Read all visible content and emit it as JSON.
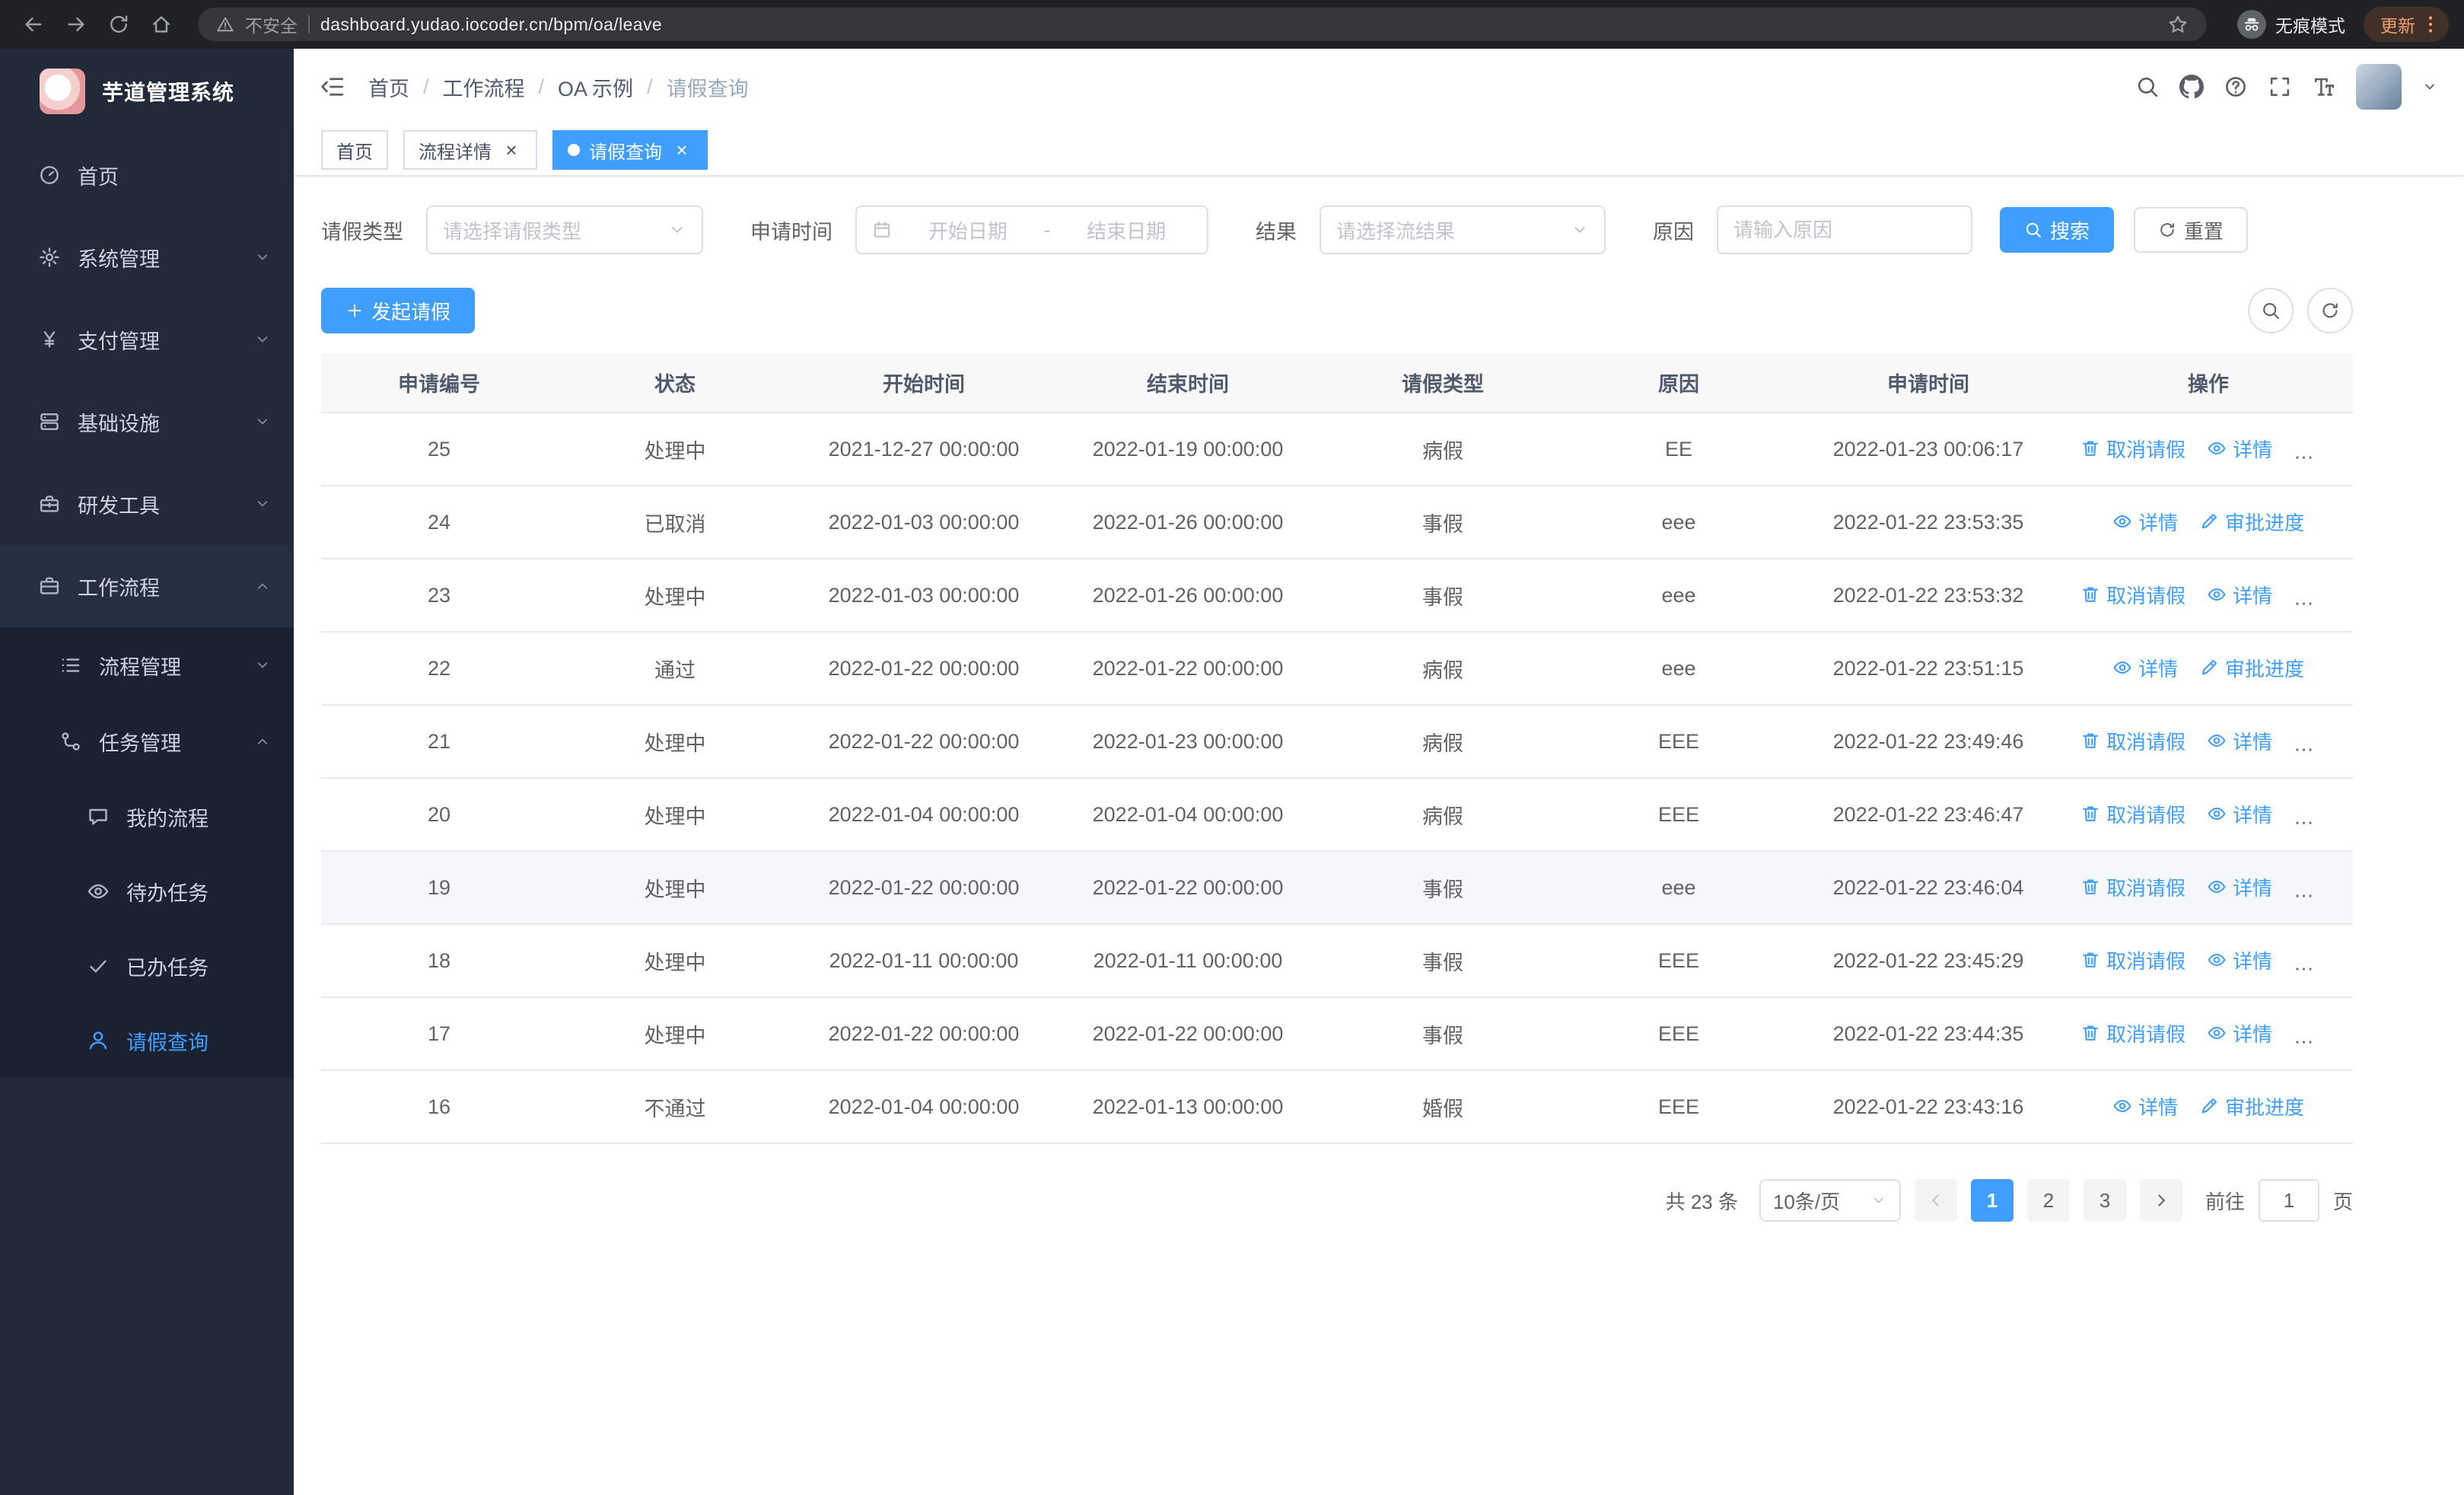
{
  "colors": {
    "primary": "#409eff",
    "sidebar_bg": "#222a3a",
    "submenu_bg": "#1a2130"
  },
  "browser": {
    "security_label": "不安全",
    "url": "dashboard.yudao.iocoder.cn/bpm/oa/leave",
    "incognito_label": "无痕模式",
    "update_label": "更新"
  },
  "sidebar": {
    "logo_title": "芋道管理系统",
    "items": [
      {
        "name": "home",
        "label": "首页",
        "icon": "dashboard",
        "level": 0
      },
      {
        "name": "system-management",
        "label": "系统管理",
        "icon": "gear",
        "level": 0,
        "arrow": "down"
      },
      {
        "name": "payment-management",
        "label": "支付管理",
        "icon": "yen",
        "level": 0,
        "arrow": "down"
      },
      {
        "name": "infrastructure",
        "label": "基础设施",
        "icon": "server",
        "level": 0,
        "arrow": "down"
      },
      {
        "name": "dev-tools",
        "label": "研发工具",
        "icon": "toolbox",
        "level": 0,
        "arrow": "down"
      },
      {
        "name": "workflow",
        "label": "工作流程",
        "icon": "briefcase",
        "level": 0,
        "arrow": "up",
        "open": true
      },
      {
        "name": "process-management",
        "label": "流程管理",
        "icon": "list",
        "level": 1,
        "arrow": "down",
        "sub": true
      },
      {
        "name": "task-management",
        "label": "任务管理",
        "icon": "flow",
        "level": 1,
        "arrow": "up",
        "sub": true
      },
      {
        "name": "my-process",
        "label": "我的流程",
        "icon": "chat",
        "level": 2,
        "sub": true
      },
      {
        "name": "todo-tasks",
        "label": "待办任务",
        "icon": "eye",
        "level": 2,
        "sub": true
      },
      {
        "name": "done-tasks",
        "label": "已办任务",
        "icon": "check",
        "level": 2,
        "sub": true
      },
      {
        "name": "leave-query",
        "label": "请假查询",
        "icon": "user",
        "level": 2,
        "sub": true,
        "active": true
      }
    ]
  },
  "header": {
    "breadcrumb": [
      "首页",
      "工作流程",
      "OA 示例",
      "请假查询"
    ]
  },
  "tabs": [
    {
      "label": "首页",
      "closable": false,
      "active": false
    },
    {
      "label": "流程详情",
      "closable": true,
      "active": false
    },
    {
      "label": "请假查询",
      "closable": true,
      "active": true
    }
  ],
  "filters": {
    "type_label": "请假类型",
    "type_placeholder": "请选择请假类型",
    "time_label": "申请时间",
    "start_placeholder": "开始日期",
    "range_separator": "-",
    "end_placeholder": "结束日期",
    "result_label": "结果",
    "result_placeholder": "请选择流结果",
    "reason_label": "原因",
    "reason_placeholder": "请输入原因",
    "search_label": "搜索",
    "reset_label": "重置"
  },
  "toolbar": {
    "create_label": "发起请假"
  },
  "table": {
    "columns": [
      "申请编号",
      "状态",
      "开始时间",
      "结束时间",
      "请假类型",
      "原因",
      "申请时间",
      "操作"
    ],
    "action_labels": {
      "cancel": "取消请假",
      "detail": "详情",
      "progress": "审批进度"
    },
    "action_icons": {
      "cancel": "delete",
      "detail": "eye",
      "progress": "edit"
    },
    "rows": [
      {
        "id": "25",
        "status": "处理中",
        "start": "2021-12-27 00:00:00",
        "end": "2022-01-19 00:00:00",
        "type": "病假",
        "reason": "EE",
        "apply": "2022-01-23 00:06:17",
        "actions": [
          "cancel",
          "detail",
          "progress"
        ],
        "highlight": false
      },
      {
        "id": "24",
        "status": "已取消",
        "start": "2022-01-03 00:00:00",
        "end": "2022-01-26 00:00:00",
        "type": "事假",
        "reason": "eee",
        "apply": "2022-01-22 23:53:35",
        "actions": [
          "detail",
          "progress"
        ],
        "highlight": false
      },
      {
        "id": "23",
        "status": "处理中",
        "start": "2022-01-03 00:00:00",
        "end": "2022-01-26 00:00:00",
        "type": "事假",
        "reason": "eee",
        "apply": "2022-01-22 23:53:32",
        "actions": [
          "cancel",
          "detail",
          "progress"
        ],
        "highlight": false
      },
      {
        "id": "22",
        "status": "通过",
        "start": "2022-01-22 00:00:00",
        "end": "2022-01-22 00:00:00",
        "type": "病假",
        "reason": "eee",
        "apply": "2022-01-22 23:51:15",
        "actions": [
          "detail",
          "progress"
        ],
        "highlight": false
      },
      {
        "id": "21",
        "status": "处理中",
        "start": "2022-01-22 00:00:00",
        "end": "2022-01-23 00:00:00",
        "type": "病假",
        "reason": "EEE",
        "apply": "2022-01-22 23:49:46",
        "actions": [
          "cancel",
          "detail",
          "progress"
        ],
        "highlight": false
      },
      {
        "id": "20",
        "status": "处理中",
        "start": "2022-01-04 00:00:00",
        "end": "2022-01-04 00:00:00",
        "type": "病假",
        "reason": "EEE",
        "apply": "2022-01-22 23:46:47",
        "actions": [
          "cancel",
          "detail",
          "progress"
        ],
        "highlight": false
      },
      {
        "id": "19",
        "status": "处理中",
        "start": "2022-01-22 00:00:00",
        "end": "2022-01-22 00:00:00",
        "type": "事假",
        "reason": "eee",
        "apply": "2022-01-22 23:46:04",
        "actions": [
          "cancel",
          "detail",
          "progress"
        ],
        "highlight": true
      },
      {
        "id": "18",
        "status": "处理中",
        "start": "2022-01-11 00:00:00",
        "end": "2022-01-11 00:00:00",
        "type": "事假",
        "reason": "EEE",
        "apply": "2022-01-22 23:45:29",
        "actions": [
          "cancel",
          "detail",
          "progress"
        ],
        "highlight": false
      },
      {
        "id": "17",
        "status": "处理中",
        "start": "2022-01-22 00:00:00",
        "end": "2022-01-22 00:00:00",
        "type": "事假",
        "reason": "EEE",
        "apply": "2022-01-22 23:44:35",
        "actions": [
          "cancel",
          "detail",
          "progress"
        ],
        "highlight": false
      },
      {
        "id": "16",
        "status": "不通过",
        "start": "2022-01-04 00:00:00",
        "end": "2022-01-13 00:00:00",
        "type": "婚假",
        "reason": "EEE",
        "apply": "2022-01-22 23:43:16",
        "actions": [
          "detail",
          "progress"
        ],
        "highlight": false
      }
    ]
  },
  "pagination": {
    "total_label": "共 23 条",
    "page_size_label": "10条/页",
    "pages": [
      "1",
      "2",
      "3"
    ],
    "active_page": "1",
    "goto_label": "前往",
    "goto_value": "1",
    "unit_label": "页"
  }
}
